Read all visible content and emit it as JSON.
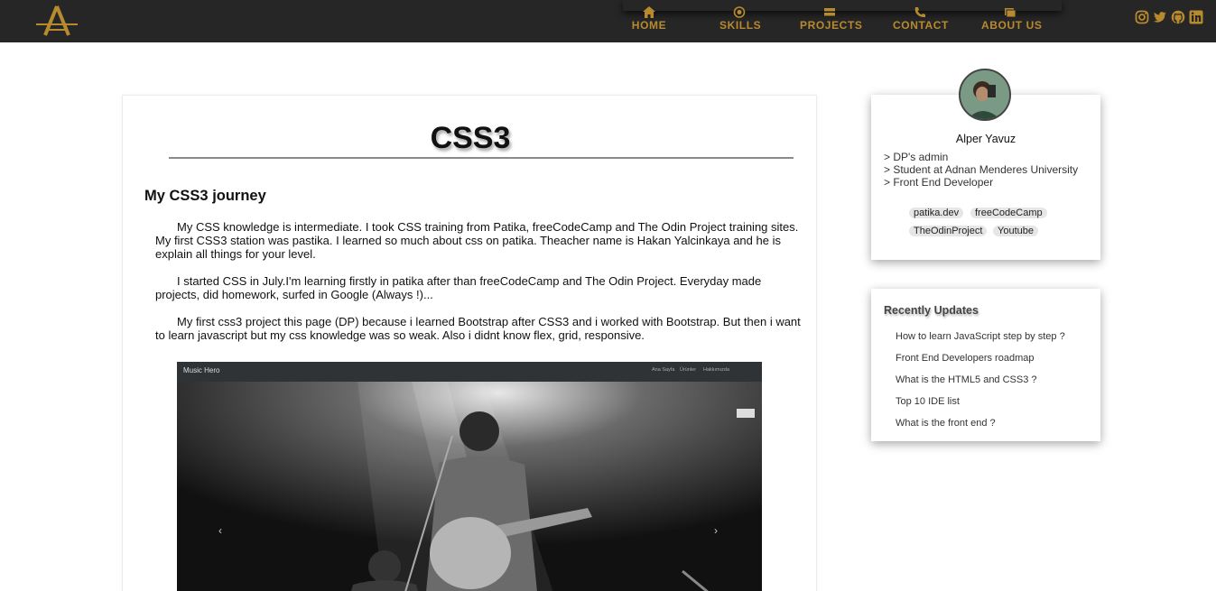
{
  "nav": {
    "logo_icon": "letter-a-logo-icon",
    "accent": "#b88a2f",
    "background": "#262626",
    "links": [
      {
        "label": "HOME",
        "icon": "home-icon"
      },
      {
        "label": "SKILLS",
        "icon": "target-icon"
      },
      {
        "label": "PROJECTS",
        "icon": "folder-icon"
      },
      {
        "label": "CONTACT",
        "icon": "phone-icon"
      },
      {
        "label": "ABOUT US",
        "icon": "card-icon"
      }
    ],
    "social": [
      "instagram-icon",
      "twitter-icon",
      "github-icon",
      "linkedin-icon"
    ]
  },
  "article": {
    "title": "CSS3",
    "subtitle": "My CSS3 journey",
    "paragraphs": [
      "My CSS knowledge is intermediate. I took CSS training from Patika, freeCodeCamp and The Odin Project training sites. My first CSS3 station was pastika. I learned so much about css on patika. Theacher name is Hakan Yalcinkaya and he is explain all things for your level.",
      "I started CSS in July.I'm learning firstly in patika after than freeCodeCamp and The Odin Project. Everyday made projects, did homework, surfed in Google (Always !)...",
      "My first css3 project this page (DP) because i learned Bootstrap after CSS3 and i worked with Bootstrap. But then i want to learn javascript but my css knowledge was so weak. Also i didnt know flex, grid, responsive."
    ],
    "screenshot": {
      "brand": "Music Hero",
      "nav": [
        "Ana Sayfa",
        "Ürünler",
        "Hakkımızda"
      ],
      "prev": "‹",
      "next": "›"
    }
  },
  "profile": {
    "avatar_icon": "profile-photo-icon",
    "name": "Alper Yavuz",
    "lines": [
      "> DP's admin",
      "> Student at Adnan Menderes University",
      "> Front End Developer"
    ],
    "tags": [
      "patika.dev",
      "freeCodeCamp",
      "TheOdinProject",
      "Youtube"
    ]
  },
  "updates": {
    "title": "Recently Updates",
    "items": [
      "How to learn JavaScript step by step ?",
      "Front End Developers roadmap",
      "What is the HTML5 and CSS3 ?",
      "Top 10 IDE list",
      "What is the front end ?"
    ]
  }
}
